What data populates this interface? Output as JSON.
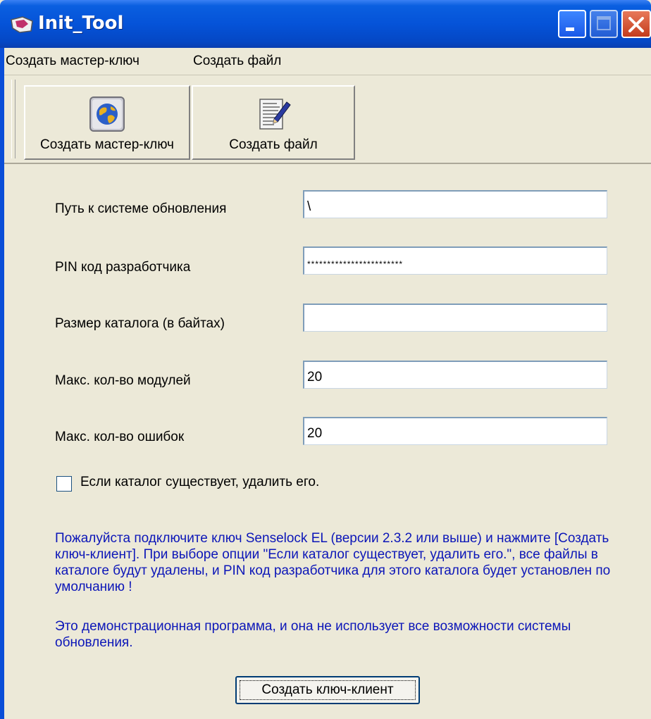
{
  "window": {
    "title": "Init_Tool"
  },
  "menu": {
    "items": [
      "Создать мастер-ключ",
      "Создать файл"
    ]
  },
  "toolbar": {
    "buttons": [
      {
        "label": "Создать мастер-ключ",
        "icon": "globe-icon"
      },
      {
        "label": "Создать файл",
        "icon": "document-edit-icon"
      }
    ]
  },
  "form": {
    "fields": [
      {
        "label": "Путь к системе обновления",
        "value": "\\"
      },
      {
        "label": "PIN код разработчика",
        "value": "************************"
      },
      {
        "label": "Размер каталога (в байтах)",
        "value": ""
      },
      {
        "label": "Макс. кол-во модулей",
        "value": "20"
      },
      {
        "label": "Макс. кол-во ошибок",
        "value": "20"
      }
    ],
    "checkbox": {
      "label": "Если каталог существует, удалить его.",
      "checked": false
    }
  },
  "info": {
    "paragraph1": "Пожалуйста подключите ключ Senselock EL (версии 2.3.2 или выше) и нажмите [Создать ключ-клиент]. При выборе опции \"Если каталог существует, удалить его.\", все файлы в каталоге будут удалены, и PIN код разработчика для этого каталога будет установлен по умолчанию !",
    "paragraph2": "Это демонстрационная программа, и она не использует все возможности системы обновления."
  },
  "actions": {
    "create_client_label": "Создать ключ-клиент"
  },
  "colors": {
    "titlebar": "#0553d8",
    "window_bg": "#ece9d8",
    "info_text": "#0c16b8",
    "close_button": "#c43c1c"
  }
}
